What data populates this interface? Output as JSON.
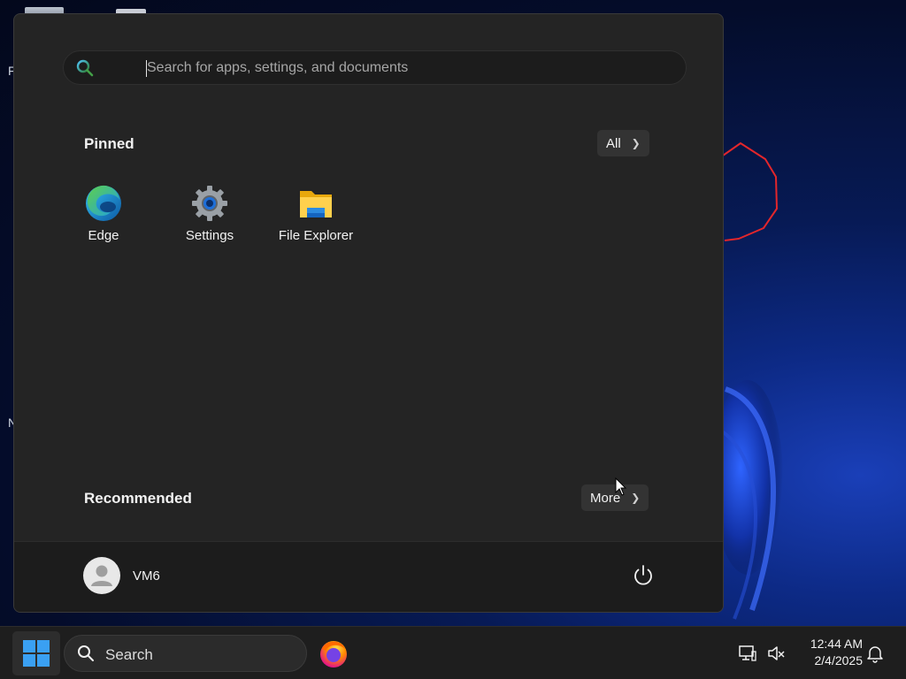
{
  "start_menu": {
    "search_placeholder": "Search for apps, settings, and documents",
    "pinned": {
      "title": "Pinned",
      "all_label": "All",
      "apps": [
        {
          "label": "Edge",
          "icon": "edge-icon"
        },
        {
          "label": "Settings",
          "icon": "gear-icon"
        },
        {
          "label": "File Explorer",
          "icon": "folder-icon"
        }
      ]
    },
    "recommended": {
      "title": "Recommended",
      "more_label": "More"
    },
    "user": {
      "name": "VM6"
    },
    "power_icon": "power-icon"
  },
  "taskbar": {
    "search_label": "Search",
    "start_icon": "windows-logo-icon",
    "pinned_apps": [
      {
        "icon": "firefox-icon"
      }
    ],
    "clock": {
      "time": "12:44 AM",
      "date": "2/4/2025"
    },
    "tray_icons": [
      "network-icon",
      "volume-muted-icon",
      "notification-bell-icon"
    ]
  },
  "colors": {
    "menu_bg": "#242424",
    "user_bar_bg": "#1c1c1c",
    "taskbar_bg": "#1e1e1e",
    "accent": "#0078d4"
  }
}
